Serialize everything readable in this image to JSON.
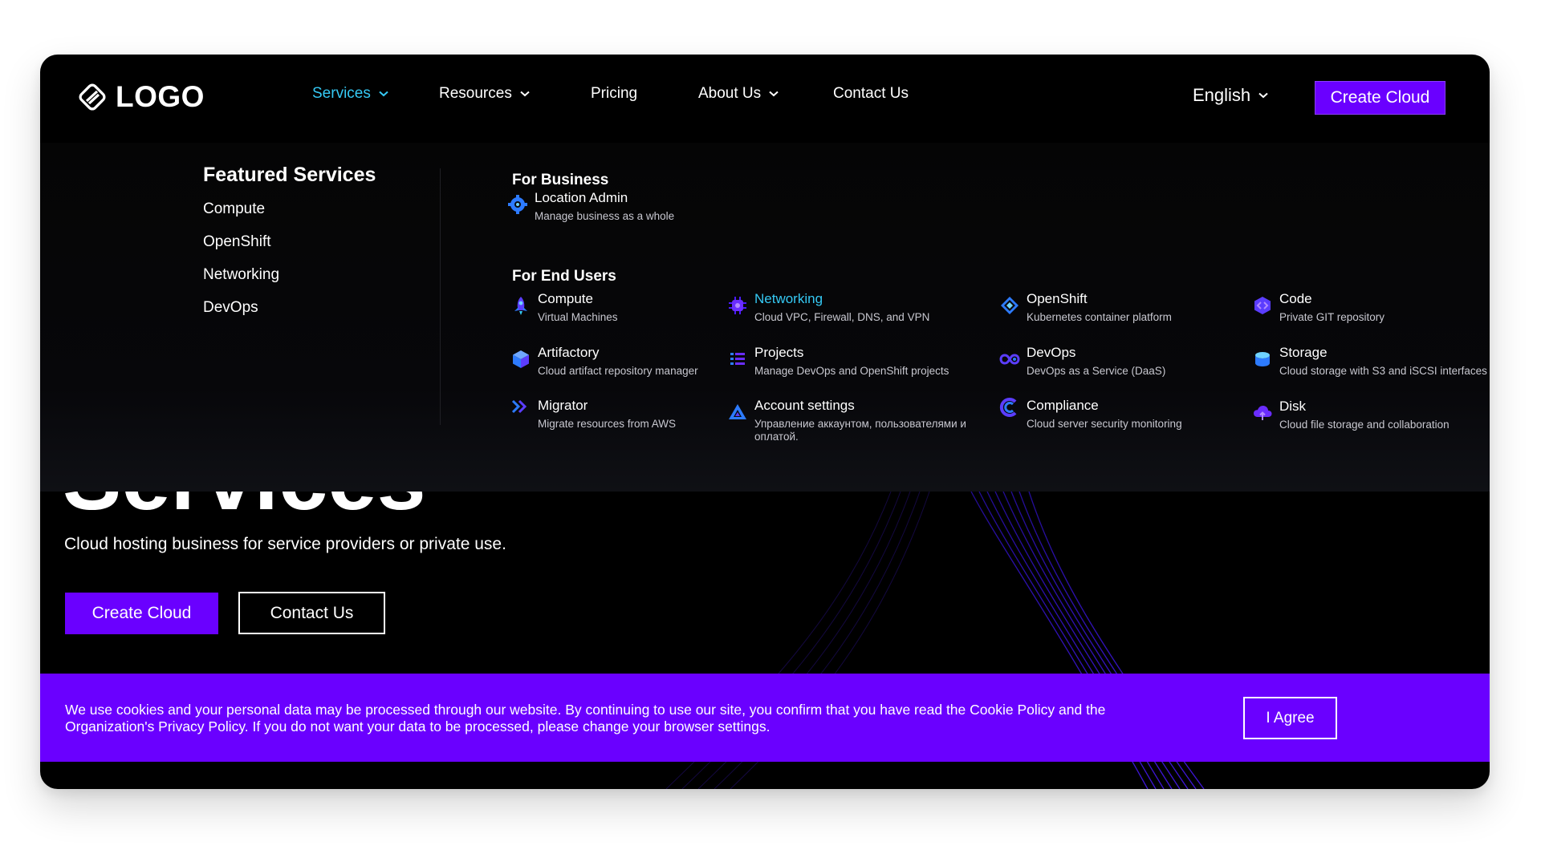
{
  "logo": {
    "text": "LOGO"
  },
  "nav": {
    "services": "Services",
    "resources": "Resources",
    "pricing": "Pricing",
    "about": "About Us",
    "contact": "Contact Us"
  },
  "language": "English",
  "create_cloud": "Create Cloud",
  "menu": {
    "featured": {
      "title": "Featured Services",
      "links": [
        "Compute",
        "OpenShift",
        "Networking",
        "DevOps"
      ]
    },
    "business": {
      "title": "For Business",
      "items": [
        {
          "name": "Location Admin",
          "desc": "Manage business as a whole",
          "icon": "gear-icon"
        }
      ]
    },
    "end_users": {
      "title": "For End Users",
      "items": [
        {
          "name": "Compute",
          "desc": "Virtual Machines",
          "icon": "rocket-icon"
        },
        {
          "name": "Networking",
          "desc": "Cloud VPC, Firewall, DNS, and VPN",
          "icon": "network-chip-icon"
        },
        {
          "name": "OpenShift",
          "desc": "Kubernetes container platform",
          "icon": "openshift-diamond-icon"
        },
        {
          "name": "Code",
          "desc": "Private GIT repository",
          "icon": "code-icon"
        },
        {
          "name": "Artifactory",
          "desc": "Cloud artifact repository manager",
          "icon": "cube-icon"
        },
        {
          "name": "Projects",
          "desc": "Manage DevOps and OpenShift projects",
          "icon": "list-icon"
        },
        {
          "name": "DevOps",
          "desc": "DevOps as a Service (DaaS)",
          "icon": "infinity-icon"
        },
        {
          "name": "Storage",
          "desc": "Cloud storage with S3 and iSCSI interfaces",
          "icon": "storage-icon"
        },
        {
          "name": "Migrator",
          "desc": "Migrate resources from AWS",
          "icon": "double-chevron-icon"
        },
        {
          "name": "Account settings",
          "desc": "Управление аккаунтом, пользователями и оплатой.",
          "icon": "triangle-icon"
        },
        {
          "name": "Compliance",
          "desc": "Cloud server security monitoring",
          "icon": "compliance-icon"
        },
        {
          "name": "Disk",
          "desc": "Cloud file storage and collaboration",
          "icon": "cloud-upload-icon"
        }
      ]
    }
  },
  "hero": {
    "title": "Services",
    "subtitle": "Cloud hosting business for service providers or private use.",
    "primary_button": "Create Cloud",
    "secondary_button": "Contact Us"
  },
  "cookie": {
    "text": "We use cookies and your personal data may be processed through our website. By continuing to use our site, you confirm that you have read the Cookie Policy and the Organization's Privacy Policy. If you do not want your data to be processed, please change your browser settings.",
    "button": "I Agree"
  },
  "colors": {
    "accent": "#6a00ff",
    "highlight": "#35c9f4",
    "background": "#000000"
  }
}
